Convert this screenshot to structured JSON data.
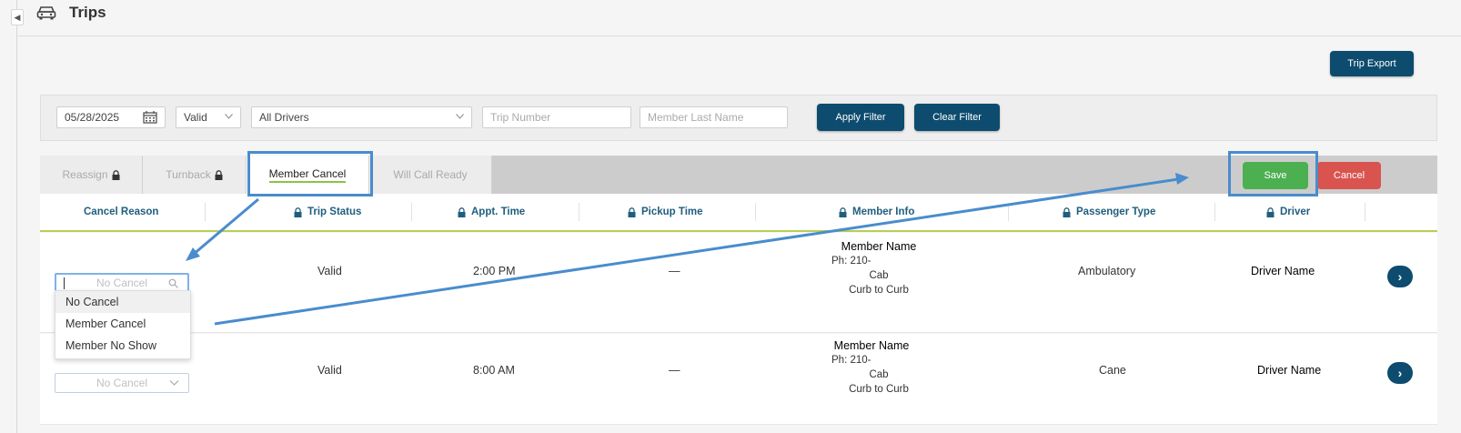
{
  "page": {
    "title": "Trips",
    "collapse_glyph": "◀",
    "icon": "car-icon"
  },
  "toolbar": {
    "trip_export_label": "Trip Export"
  },
  "filters": {
    "date": "05/28/2025",
    "status": "Valid",
    "drivers": "All Drivers",
    "trip_number_placeholder": "Trip Number",
    "member_last_name_placeholder": "Member Last Name",
    "apply_label": "Apply Filter",
    "clear_label": "Clear Filter"
  },
  "tabs": [
    {
      "label": "Reassign",
      "locked": true,
      "active": false
    },
    {
      "label": "Turnback",
      "locked": true,
      "active": false
    },
    {
      "label": "Member Cancel",
      "locked": false,
      "active": true
    },
    {
      "label": "Will Call Ready",
      "locked": false,
      "active": false
    }
  ],
  "actions": {
    "save_label": "Save",
    "cancel_label": "Cancel"
  },
  "columns": [
    "Cancel Reason",
    "Trip Status",
    "Appt. Time",
    "Pickup Time",
    "Member Info",
    "Passenger Type",
    "Driver"
  ],
  "rows": [
    {
      "cancel_reason": "No Cancel",
      "trip_status": "Valid",
      "appt_time": "2:00 PM",
      "pickup_time": "—",
      "member_name": "Member Name",
      "phone": "Ph: 210-",
      "vehicle": "Cab",
      "service": "Curb to Curb",
      "passenger_type": "Ambulatory",
      "driver": "Driver Name",
      "go_glyph": "›"
    },
    {
      "cancel_reason": "No Cancel",
      "trip_status": "Valid",
      "appt_time": "8:00 AM",
      "pickup_time": "—",
      "member_name": "Member Name",
      "phone": "Ph: 210-",
      "vehicle": "Cab",
      "service": "Curb to Curb",
      "passenger_type": "Cane",
      "driver": "Driver Name",
      "go_glyph": "›"
    }
  ],
  "cancel_reason_options": [
    "No Cancel",
    "Member Cancel",
    "Member No Show"
  ],
  "colors": {
    "primary": "#0d4c6e",
    "save": "#4caf50",
    "cancel": "#d9534f",
    "header_text": "#1f5e7e",
    "annotation": "#4a8ccd",
    "tab_underline": "#8bc34a"
  }
}
